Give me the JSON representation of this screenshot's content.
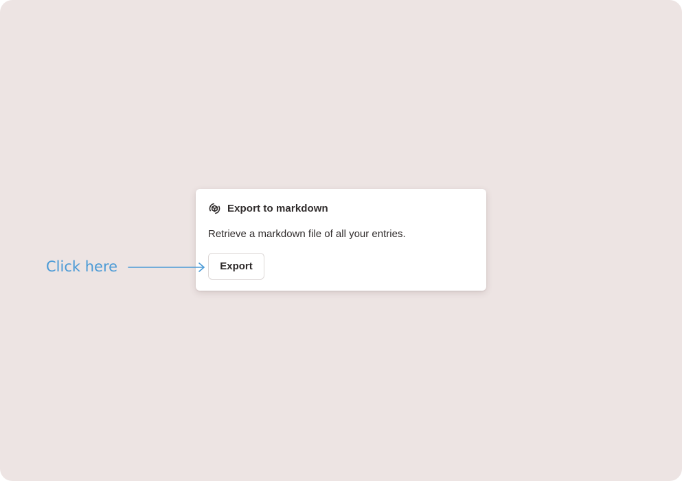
{
  "colors": {
    "background": "#ede4e3",
    "card": "#ffffff",
    "text": "#2f2b2b",
    "accent": "#4a9ad6"
  },
  "card": {
    "icon": "export-cube-icon",
    "title": "Export to markdown",
    "description": "Retrieve a markdown file of all your entries.",
    "button_label": "Export"
  },
  "annotation": {
    "label": "Click here",
    "icon": "arrow-right-icon"
  }
}
